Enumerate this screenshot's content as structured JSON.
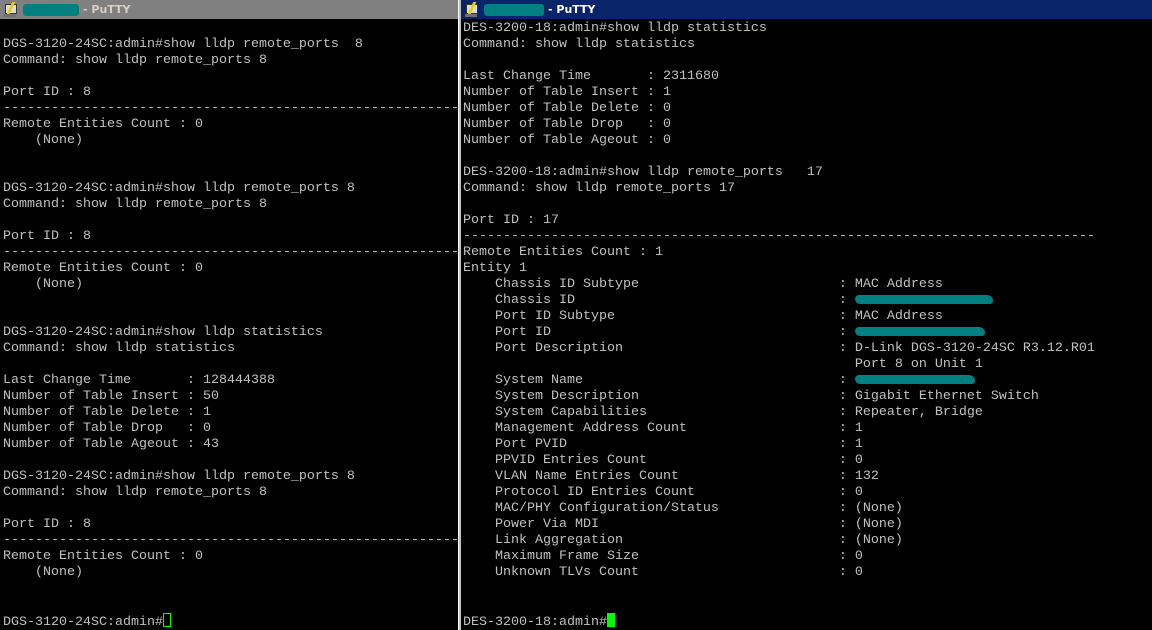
{
  "left": {
    "title": "- PuTTY",
    "lines": [
      "",
      "DGS-3120-24SC:admin#show lldp remote_ports  8",
      "Command: show lldp remote_ports 8",
      "",
      "Port ID : 8",
      "---------------------------------------------------------",
      "Remote Entities Count : 0",
      "    (None)",
      "",
      "",
      "DGS-3120-24SC:admin#show lldp remote_ports 8",
      "Command: show lldp remote_ports 8",
      "",
      "Port ID : 8",
      "---------------------------------------------------------",
      "Remote Entities Count : 0",
      "    (None)",
      "",
      "",
      "DGS-3120-24SC:admin#show lldp statistics",
      "Command: show lldp statistics",
      "",
      "Last Change Time       : 128444388",
      "Number of Table Insert : 50",
      "Number of Table Delete : 1",
      "Number of Table Drop   : 0",
      "Number of Table Ageout : 43",
      "",
      "DGS-3120-24SC:admin#show lldp remote_ports 8",
      "Command: show lldp remote_ports 8",
      "",
      "Port ID : 8",
      "---------------------------------------------------------",
      "Remote Entities Count : 0",
      "    (None)",
      "",
      ""
    ],
    "prompt": "DGS-3120-24SC:admin#"
  },
  "right": {
    "title": "- PuTTY",
    "lines": [
      "DES-3200-18:admin#show lldp statistics",
      "Command: show lldp statistics",
      "",
      "Last Change Time       : 2311680",
      "Number of Table Insert : 1",
      "Number of Table Delete : 0",
      "Number of Table Drop   : 0",
      "Number of Table Ageout : 0",
      "",
      "DES-3200-18:admin#show lldp remote_ports   17",
      "Command: show lldp remote_ports 17",
      "",
      "Port ID : 17",
      "-------------------------------------------------------------------------------",
      "Remote Entities Count : 1",
      "Entity 1"
    ],
    "entity_fields": [
      {
        "label": "Chassis ID Subtype",
        "value": "MAC Address"
      },
      {
        "label": "Chassis ID",
        "value": null,
        "redacted": true
      },
      {
        "label": "Port ID Subtype",
        "value": "MAC Address"
      },
      {
        "label": "Port ID",
        "value": null,
        "redacted": true
      },
      {
        "label": "Port Description",
        "value": "D-Link DGS-3120-24SC R3.12.R01"
      },
      {
        "label": "",
        "value": "Port 8 on Unit 1",
        "continuation": true
      },
      {
        "label": "System Name",
        "value": null,
        "redacted": true
      },
      {
        "label": "System Description",
        "value": "Gigabit Ethernet Switch"
      },
      {
        "label": "System Capabilities",
        "value": "Repeater, Bridge"
      },
      {
        "label": "Management Address Count",
        "value": "1"
      },
      {
        "label": "Port PVID",
        "value": "1"
      },
      {
        "label": "PPVID Entries Count",
        "value": "0"
      },
      {
        "label": "VLAN Name Entries Count",
        "value": "132"
      },
      {
        "label": "Protocol ID Entries Count",
        "value": "0"
      },
      {
        "label": "MAC/PHY Configuration/Status",
        "value": "(None)"
      },
      {
        "label": "Power Via MDI",
        "value": "(None)"
      },
      {
        "label": "Link Aggregation",
        "value": "(None)"
      },
      {
        "label": "Maximum Frame Size",
        "value": "0"
      },
      {
        "label": "Unknown TLVs Count",
        "value": "0"
      }
    ],
    "trailing_blank_lines": 2,
    "prompt": "DES-3200-18:admin#"
  },
  "colors": {
    "text": "#c0c0c0",
    "cursor": "#00ff00",
    "redaction": "#008080",
    "active_title": "#0a246a",
    "inactive_title": "#808080"
  }
}
